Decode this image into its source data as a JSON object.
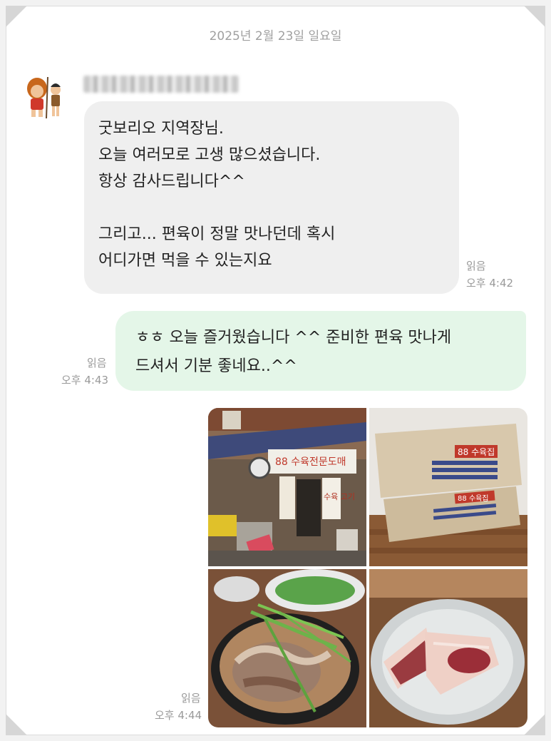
{
  "chat": {
    "date": "2025년 2월 23일 일요일",
    "incoming": {
      "lines": [
        "굿보리오 지역장님.",
        "오늘 여러모로 고생 많으셨습니다.",
        "항상 감사드립니다^^",
        "",
        "그리고... 편육이 정말 맛나던데 혹시",
        "어디가면 먹을 수 있는지요"
      ],
      "read": "읽음",
      "time": "오후 4:42"
    },
    "outgoing_text": {
      "lines": [
        "ㅎㅎ 오늘 즐거웠습니다 ^^ 준비한 편육 맛나게",
        "드셔서 기분 좋네요..^^"
      ],
      "read": "읽음",
      "time": "오후 4:43"
    },
    "outgoing_photos": {
      "read": "읽음",
      "time": "오후 4:44",
      "photo1": {
        "sign": "88 수육전문도매",
        "small_sign": "수육 고기"
      },
      "photo2": {
        "box_label": "88 수육집",
        "box_label2": "88 수육집"
      }
    }
  },
  "colors": {
    "incoming_bubble": "#efefef",
    "outgoing_bubble": "#e4f6e8",
    "meta_text": "#9a9a9a"
  }
}
